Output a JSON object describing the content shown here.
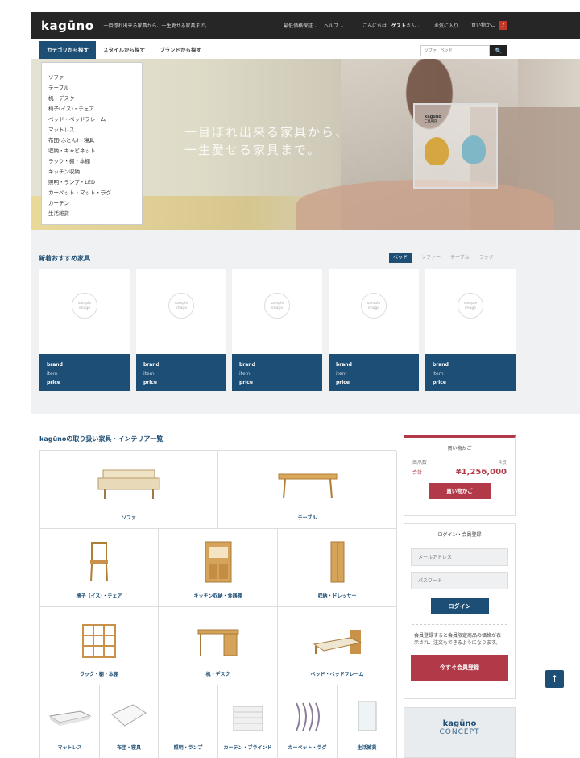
{
  "header": {
    "logo": "kagūno",
    "tagline": "一目惚れ出来る家具から、一生愛せる家具まで。",
    "nav": [
      "最低価格保証 ⌄",
      "ヘルプ ⌄"
    ],
    "greeting": "こんにちは、",
    "guest": "ゲスト",
    "greeting_suffix": "さん ⌄",
    "favorites": "お気に入り",
    "cart": "買い物かご",
    "cart_count": "7"
  },
  "tabs": [
    "カテゴリから探す",
    "スタイルから探す",
    "ブランドから探す"
  ],
  "search": {
    "placeholder": "ソファ、ベッド",
    "button": "🔍"
  },
  "hero": {
    "line1": "一目ぼれ出来る家具から、",
    "line2": "一生愛せる家具まで。",
    "chair_brand": "kagūno",
    "chair_sub": "CHAIR"
  },
  "category_menu": [
    "ソファ",
    "テーブル",
    "机・デスク",
    "椅子(イス)・チェア",
    "ベッド・ベッドフレーム",
    "マットレス",
    "布団(ふとん)・寝具",
    "収納・キャビネット",
    "ラック・棚・本棚",
    "キッチン収納",
    "照明・ランプ・LED",
    "カーペット・マット・ラグ",
    "カーテン",
    "生活雑貨"
  ],
  "recommend": {
    "title": "新着おすすめ家具",
    "tabs": [
      "ベッド",
      "ソファー",
      "テーブル",
      "ラック"
    ],
    "cards": [
      {
        "brand": "brand",
        "item": "item",
        "price": "price"
      },
      {
        "brand": "brand",
        "item": "item",
        "price": "price"
      },
      {
        "brand": "brand",
        "item": "item",
        "price": "price"
      },
      {
        "brand": "brand",
        "item": "item",
        "price": "price"
      },
      {
        "brand": "brand",
        "item": "item",
        "price": "price"
      }
    ],
    "placeholder": "sample image"
  },
  "catalog": {
    "title": "kagūnoの取り扱い家具・インテリア一覧",
    "items": [
      "ソファ",
      "テーブル",
      "椅子（イス）・チェア",
      "キッチン収納・食器棚",
      "収納・ドレッサー",
      "ラック・棚・本棚",
      "机・デスク",
      "ベッド・ベッドフレーム",
      "マットレス",
      "布団・寝具",
      "照明・ランプ",
      "カーテン・ブラインド",
      "カーペット・ラグ",
      "生活雑貨"
    ]
  },
  "cart": {
    "title": "買い物かご",
    "qty_label": "商品数",
    "qty": "3点",
    "total_label": "合計",
    "total": "¥1,256,000",
    "button": "買い物かご"
  },
  "login": {
    "title": "ログイン・会員登録",
    "email": "メールアドレス",
    "password": "パスワード",
    "button": "ログイン",
    "note": "会員登録すると会員限定商品の価格が表示され、注文もできるようになります。",
    "register": "今すぐ会員登録"
  },
  "concept": {
    "logo": "kagūno",
    "label": "CONCEPT"
  },
  "totop": "↑",
  "colors": {
    "primary": "#1d4e75",
    "accent": "#b23a48",
    "dark": "#262626"
  }
}
